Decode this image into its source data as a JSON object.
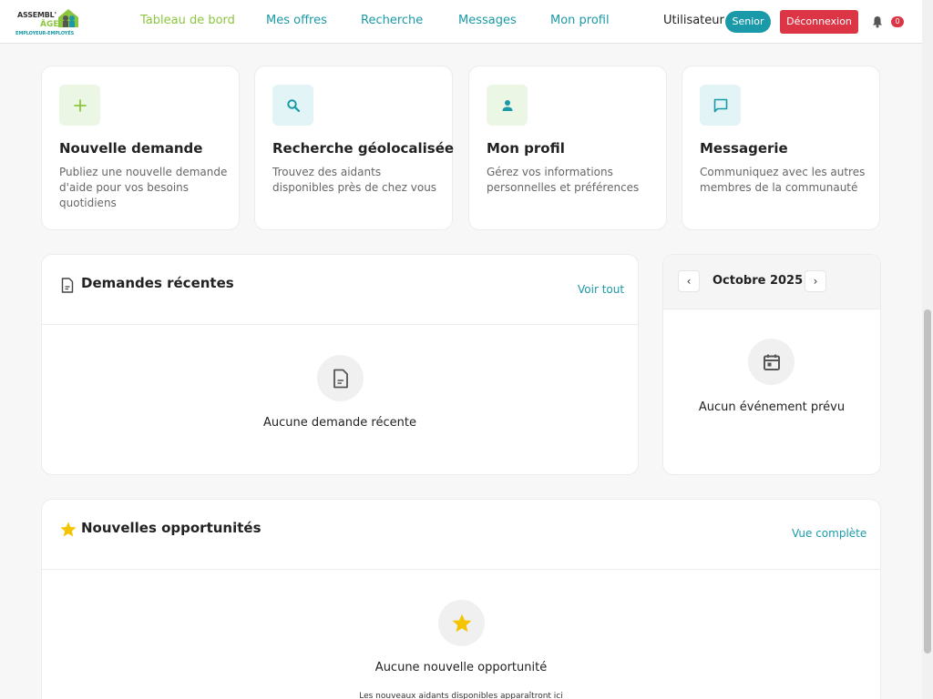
{
  "header": {
    "logo": {
      "line1": "ASSEMBL'",
      "line2": "ÂGE",
      "line3": "EMPLOYEUR-EMPLOYÉS"
    },
    "nav": [
      {
        "label": "Tableau de bord",
        "active": true
      },
      {
        "label": "Mes offres",
        "active": false
      },
      {
        "label": "Recherche",
        "active": false
      },
      {
        "label": "Messages",
        "active": false
      },
      {
        "label": "Mon profil",
        "active": false
      }
    ],
    "user_label": "Utilisateur",
    "role_badge": "Senior",
    "logout_label": "Déconnexion",
    "notifications_icon": "bell-icon",
    "notifications_count": "0"
  },
  "quick_actions": [
    {
      "icon": "plus-icon",
      "title": "Nouvelle demande",
      "description": "Publiez une nouvelle demande d'aide pour vos besoins quotidiens"
    },
    {
      "icon": "search-icon",
      "title": "Recherche géolocalisée",
      "description": "Trouvez des aidants disponibles près de chez vous"
    },
    {
      "icon": "person-icon",
      "title": "Mon profil",
      "description": "Gérez vos informations personnelles et préférences"
    },
    {
      "icon": "chat-icon",
      "title": "Messagerie",
      "description": "Communiquez avec les autres membres de la communauté"
    }
  ],
  "recent_requests": {
    "icon": "document-icon",
    "title": "Demandes récentes",
    "link": "Voir tout",
    "empty_icon": "document-icon",
    "empty_text": "Aucune demande récente"
  },
  "calendar": {
    "prev_label": "‹",
    "next_label": "›",
    "month": "Octobre 2025",
    "empty_icon": "calendar-icon",
    "empty_text": "Aucun événement prévu"
  },
  "opportunities": {
    "icon": "star-icon",
    "title": "Nouvelles opportunités",
    "link": "Vue complète",
    "empty_icon": "star-icon",
    "empty_text": "Aucune nouvelle opportunité",
    "sub_text": "Les nouveaux aidants disponibles apparaîtront ici"
  },
  "colors": {
    "accent_teal": "#1a9aa8",
    "accent_green": "#8cc63f",
    "danger": "#dc3545",
    "star": "#f5c400"
  }
}
